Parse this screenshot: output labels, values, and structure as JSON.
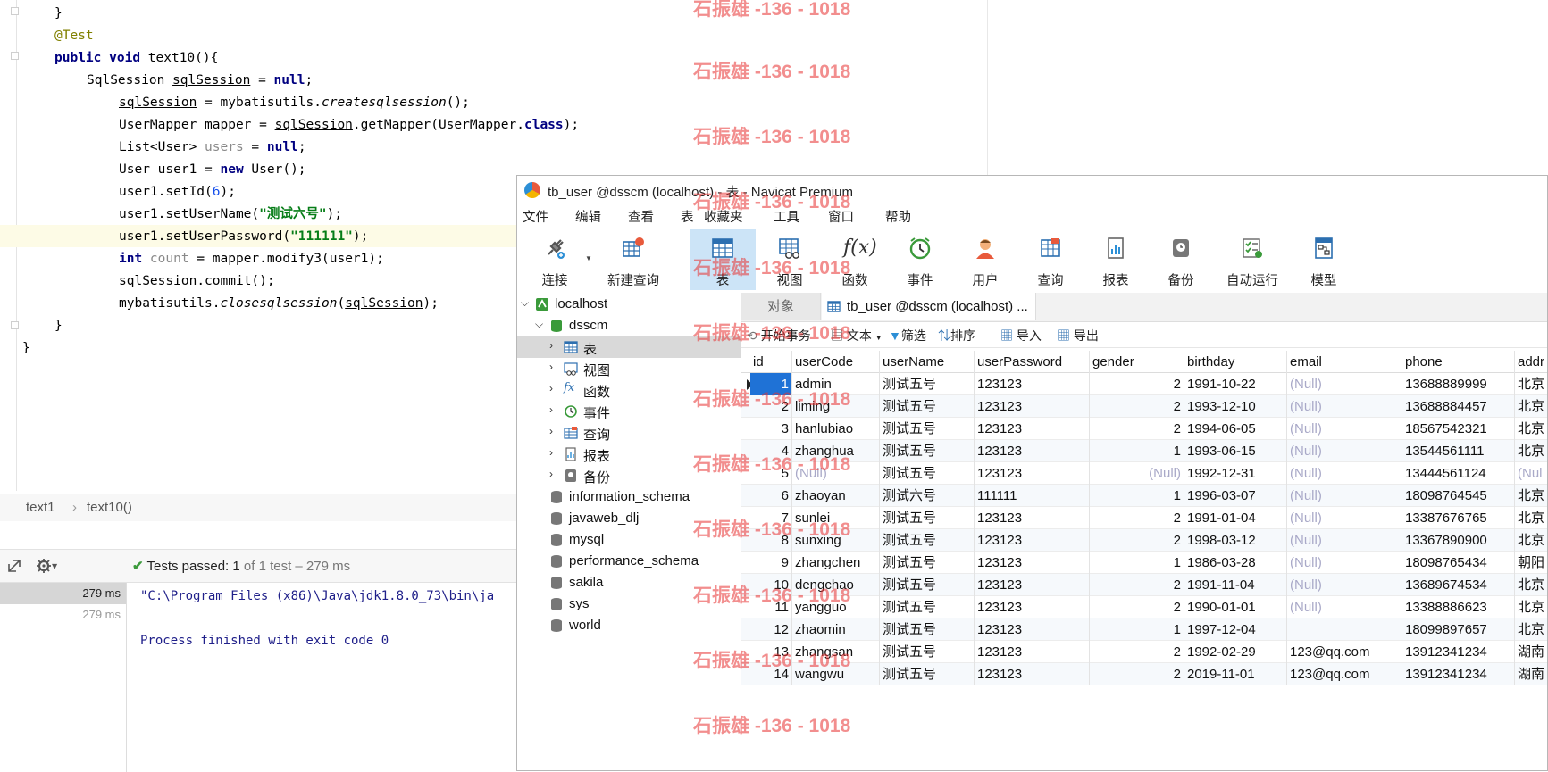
{
  "editor": {
    "lines": {
      "l0": "}",
      "l1": "@Test",
      "l2_kw1": "public",
      "l2_kw2": "void",
      "l2_rest": " text10(){",
      "l3_a": "SqlSession ",
      "l3_b": "sqlSession",
      "l3_c": " = ",
      "l3_d": "null",
      "l3_e": ";",
      "l4_a": "sqlSession",
      "l4_b": " = mybatisutils.",
      "l4_c": "createsqlsession",
      "l4_d": "();",
      "l5_a": "UserMapper mapper = ",
      "l5_b": "sqlSession",
      "l5_c": ".getMapper(UserMapper.",
      "l5_d": "class",
      "l5_e": ");",
      "l6_a": "List<User> ",
      "l6_b": "users",
      "l6_c": " = ",
      "l6_d": "null",
      "l6_e": ";",
      "l7_a": "User user1 = ",
      "l7_b": "new",
      "l7_c": " User();",
      "l8_a": "user1.setId(",
      "l8_b": "6",
      "l8_c": ");",
      "l9_a": "user1.setUserName(",
      "l9_b": "\"测试六号\"",
      "l9_c": ");",
      "l10_a": "user1.setUserPassword(",
      "l10_b": "\"111111\"",
      "l10_c": ");",
      "l11_a": "int",
      "l11_b": " count",
      "l11_c": " = mapper.modify3(user1);",
      "l12_a": "sqlSession",
      "l12_b": ".commit();",
      "l13_a": "mybatisutils.",
      "l13_b": "closesqlsession",
      "l13_c": "(",
      "l13_d": "sqlSession",
      "l13_e": ");",
      "l14": "}",
      "l15": "}"
    }
  },
  "breadcrumb": {
    "item1": "text1",
    "sep": "›",
    "item2": "text10()"
  },
  "run": {
    "tests_label": "Tests passed: ",
    "tests_count": "1",
    "tests_rest": " of 1 test – 279 ms",
    "tree_ms_1": "279 ms",
    "tree_ms_2": "279 ms",
    "console_line1": "\"C:\\Program Files (x86)\\Java\\jdk1.8.0_73\\bin\\ja",
    "console_line2": "Process finished with exit code 0"
  },
  "navicat": {
    "title": "tb_user @dsscm (localhost) - 表 - Navicat Premium",
    "menu": [
      "文件",
      "编辑",
      "查看",
      "表",
      "收藏夹",
      "工具",
      "窗口",
      "帮助"
    ],
    "toolbar": [
      "连接",
      "新建查询",
      "表",
      "视图",
      "函数",
      "事件",
      "用户",
      "查询",
      "报表",
      "备份",
      "自动运行",
      "模型"
    ],
    "tree": {
      "localhost": "localhost",
      "dsscm": "dsscm",
      "items": [
        "表",
        "视图",
        "函数",
        "事件",
        "查询",
        "报表",
        "备份"
      ],
      "databases": [
        "information_schema",
        "javaweb_dlj",
        "mysql",
        "performance_schema",
        "sakila",
        "sys",
        "world"
      ]
    },
    "tabs": {
      "objects": "对象",
      "table": "tb_user @dsscm (localhost) ..."
    },
    "subtoolbar": [
      "开始事务",
      "文本",
      "筛选",
      "排序",
      "导入",
      "导出"
    ],
    "grid": {
      "columns": [
        "id",
        "userCode",
        "userName",
        "userPassword",
        "gender",
        "birthday",
        "email",
        "phone",
        "addr"
      ],
      "rows": [
        [
          "1",
          "admin",
          "测试五号",
          "123123",
          "2",
          "1991-10-22",
          "(Null)",
          "13688889999",
          "北京"
        ],
        [
          "2",
          "liming",
          "测试五号",
          "123123",
          "2",
          "1993-12-10",
          "(Null)",
          "13688884457",
          "北京"
        ],
        [
          "3",
          "hanlubiao",
          "测试五号",
          "123123",
          "2",
          "1994-06-05",
          "(Null)",
          "18567542321",
          "北京"
        ],
        [
          "4",
          "zhanghua",
          "测试五号",
          "123123",
          "1",
          "1993-06-15",
          "(Null)",
          "13544561111",
          "北京"
        ],
        [
          "5",
          "(Null)",
          "测试五号",
          "123123",
          "(Null)",
          "1992-12-31",
          "(Null)",
          "13444561124",
          "(Nul"
        ],
        [
          "6",
          "zhaoyan",
          "测试六号",
          "111111",
          "1",
          "1996-03-07",
          "(Null)",
          "18098764545",
          "北京"
        ],
        [
          "7",
          "sunlei",
          "测试五号",
          "123123",
          "2",
          "1991-01-04",
          "(Null)",
          "13387676765",
          "北京"
        ],
        [
          "8",
          "sunxing",
          "测试五号",
          "123123",
          "2",
          "1998-03-12",
          "(Null)",
          "13367890900",
          "北京"
        ],
        [
          "9",
          "zhangchen",
          "测试五号",
          "123123",
          "1",
          "1986-03-28",
          "(Null)",
          "18098765434",
          "朝阳"
        ],
        [
          "10",
          "dengchao",
          "测试五号",
          "123123",
          "2",
          "1991-11-04",
          "(Null)",
          "13689674534",
          "北京"
        ],
        [
          "11",
          "yangguo",
          "测试五号",
          "123123",
          "2",
          "1990-01-01",
          "(Null)",
          "13388886623",
          "北京"
        ],
        [
          "12",
          "zhaomin",
          "测试五号",
          "123123",
          "1",
          "1997-12-04",
          "",
          "18099897657",
          "北京"
        ],
        [
          "13",
          "zhangsan",
          "测试五号",
          "123123",
          "2",
          "1992-02-29",
          "123@qq.com",
          "13912341234",
          "湖南"
        ],
        [
          "14",
          "wangwu",
          "测试五号",
          "123123",
          "2",
          "2019-11-01",
          "123@qq.com",
          "13912341234",
          "湖南"
        ]
      ]
    }
  },
  "watermark": "石振雄 -136 - 1018"
}
